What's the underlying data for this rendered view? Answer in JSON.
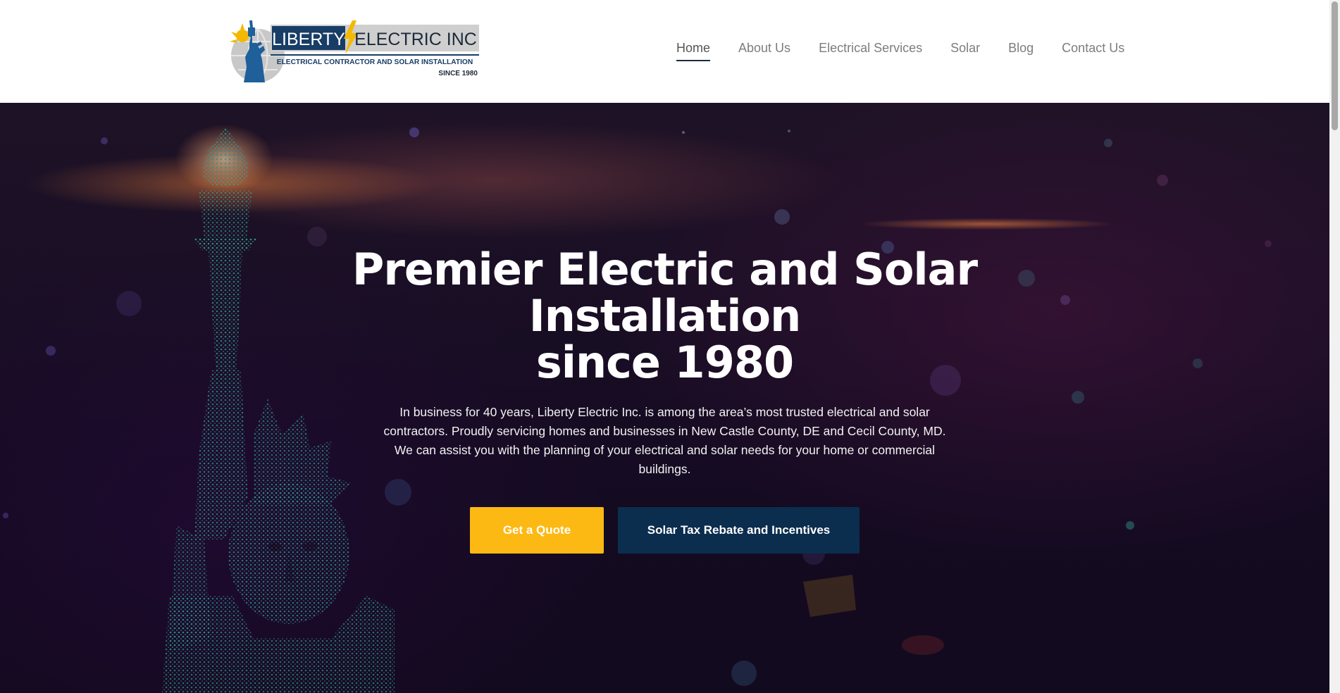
{
  "header": {
    "logo": {
      "brand_word_1": "LIBERTY",
      "brand_word_2": "ELECTRIC INC",
      "tagline": "ELECTRICAL CONTRACTOR AND SOLAR INSTALLATION",
      "since": "SINCE 1980"
    },
    "nav": {
      "items": [
        {
          "label": "Home",
          "active": true
        },
        {
          "label": "About Us",
          "active": false
        },
        {
          "label": "Electrical Services",
          "active": false
        },
        {
          "label": "Solar",
          "active": false
        },
        {
          "label": "Blog",
          "active": false
        },
        {
          "label": "Contact Us",
          "active": false
        }
      ]
    }
  },
  "hero": {
    "title_line_1": "Premier Electric and Solar",
    "title_line_2": "Installation",
    "title_line_3": "since 1980",
    "description": "In business for 40 years, Liberty Electric Inc. is among the area’s most trusted electrical and solar contractors. Proudly servicing homes and businesses in New Castle County, DE and Cecil County, MD. We can assist you with the planning of your electrical and solar needs for your home or commercial buildings.",
    "buttons": {
      "quote_label": "Get a Quote",
      "solar_label": "Solar Tax Rebate and Incentives"
    }
  },
  "colors": {
    "accent_yellow": "#fdb913",
    "navy": "#0b2d4e",
    "hero_background": "#150b22",
    "statue_teal": "#2fa69a"
  },
  "icons": {
    "logo_mark": "statue-of-liberty-logo-icon",
    "lightning": "lightning-bolt-icon"
  }
}
